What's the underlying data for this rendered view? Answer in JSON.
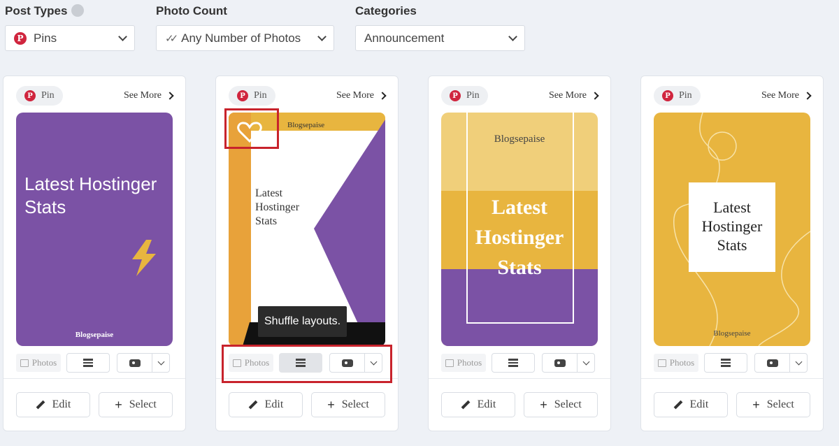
{
  "filters": {
    "post_types": {
      "label": "Post Types",
      "value": "Pins"
    },
    "photo_count": {
      "label": "Photo Count",
      "value": "Any Number of Photos"
    },
    "categories": {
      "label": "Categories",
      "value": "Announcement"
    }
  },
  "cards": [
    {
      "chip": "Pin",
      "see_more": "See More",
      "title": "Latest Hostinger Stats",
      "brand": "Blogsepaise",
      "photos": "Photos",
      "edit": "Edit",
      "select": "Select"
    },
    {
      "chip": "Pin",
      "see_more": "See More",
      "title": "Latest Hostinger Stats",
      "brand": "Blogsepaise",
      "photos": "Photos",
      "edit": "Edit",
      "select": "Select"
    },
    {
      "chip": "Pin",
      "see_more": "See More",
      "title": "Latest Hostinger Stats",
      "brand": "Blogsepaise",
      "photos": "Photos",
      "edit": "Edit",
      "select": "Select"
    },
    {
      "chip": "Pin",
      "see_more": "See More",
      "title": "Latest Hostinger Stats",
      "brand": "Blogsepaise",
      "photos": "Photos",
      "edit": "Edit",
      "select": "Select"
    }
  ],
  "tooltip": "Shuffle layouts.",
  "colors": {
    "purple": "#7b52a5",
    "mustard": "#e8b53f",
    "pinterest": "#d0253e",
    "highlight": "#c8232c"
  },
  "icons": [
    "info-icon",
    "pinterest-icon",
    "chevron-down-icon",
    "double-check-icon",
    "chevron-right-icon",
    "heart-icon",
    "lightning-icon",
    "photos-icon",
    "shuffle-layout-icon",
    "camera-icon",
    "pencil-icon",
    "plus-icon"
  ]
}
